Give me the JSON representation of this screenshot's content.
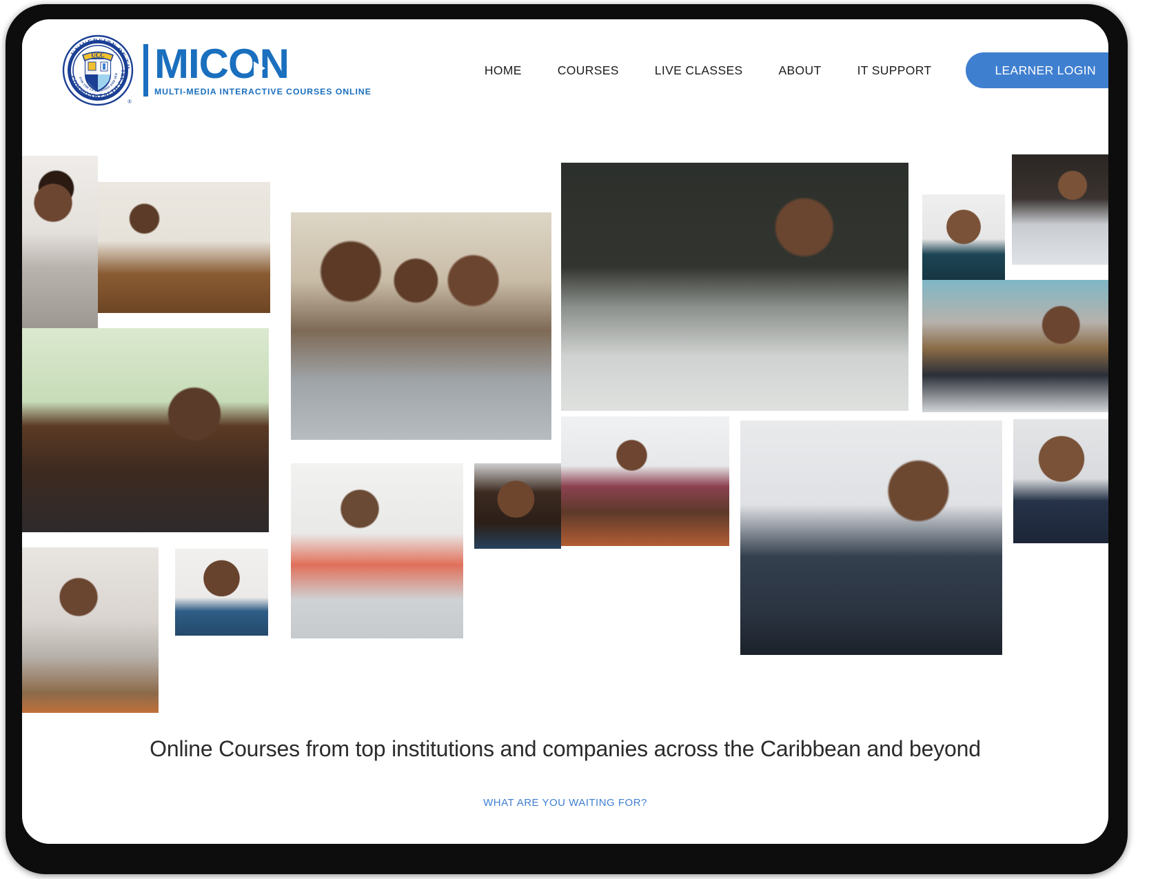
{
  "brand": {
    "crest_alt": "university-of-the-commonwealth-caribbean-crest",
    "crest_top_text": "UNIVERSITY OF THE",
    "crest_bottom_text": "COMMONWEALTH CARIBBEAN",
    "crest_ribbon_text": "UCC",
    "crest_motto": "FOR THE LEADERSHIP AND SERVICE",
    "wordmark": "MICON",
    "tagline": "MULTI-MEDIA INTERACTIVE COURSES ONLINE",
    "brand_blue": "#1a6fbe"
  },
  "nav": {
    "items": [
      {
        "label": "HOME"
      },
      {
        "label": "COURSES"
      },
      {
        "label": "LIVE CLASSES"
      },
      {
        "label": "ABOUT"
      },
      {
        "label": "IT SUPPORT"
      }
    ],
    "login_label": "LEARNER LOGIN",
    "login_color": "#3f7fd0"
  },
  "hero": {
    "tagline": "Online Courses from top institutions and companies across the Caribbean and beyond",
    "cta": "WHAT ARE YOU WAITING FOR?",
    "cta_color": "#3f7fd0"
  },
  "collage": {
    "tiles": [
      {
        "name": "tile-smiling-man-grey-blazer",
        "alt": "Smiling man in grey blazer"
      },
      {
        "name": "tile-man-on-phone-at-imac",
        "alt": "Man on phone at iMac desk"
      },
      {
        "name": "tile-man-drinking-coffee-laptop",
        "alt": "Bearded man with glasses drinking coffee by laptop"
      },
      {
        "name": "tile-woman-headband-at-imac",
        "alt": "Woman in pink headband smiling at iMac"
      },
      {
        "name": "tile-bearded-man-blue-polo",
        "alt": "Bearded man in blue polo portrait"
      },
      {
        "name": "tile-family-with-laptop",
        "alt": "Family of three looking at a laptop together"
      },
      {
        "name": "tile-woman-coral-cardigan-laptop",
        "alt": "Woman in coral cardigan with laptop in office"
      },
      {
        "name": "tile-laughing-woman-braids",
        "alt": "Laughing woman with long braids"
      },
      {
        "name": "tile-woman-striped-top-laptop",
        "alt": "Woman in striped top smiling at laptop in office"
      },
      {
        "name": "tile-couple-hugging-kitchen",
        "alt": "Couple hugging at kitchen counter with laptop"
      },
      {
        "name": "tile-businessman-writing-notes",
        "alt": "Businessman in suit writing notes at desk"
      },
      {
        "name": "tile-smiling-woman-print-blouse",
        "alt": "Smiling woman in printed blouse"
      },
      {
        "name": "tile-woman-at-computer-dark",
        "alt": "Woman working at a computer"
      },
      {
        "name": "tile-man-glasses-cafe-laptop",
        "alt": "Man with glasses on laptop in a cafe"
      },
      {
        "name": "tile-woman-navy-blazer-portrait",
        "alt": "Woman in navy blazer portrait"
      }
    ]
  }
}
